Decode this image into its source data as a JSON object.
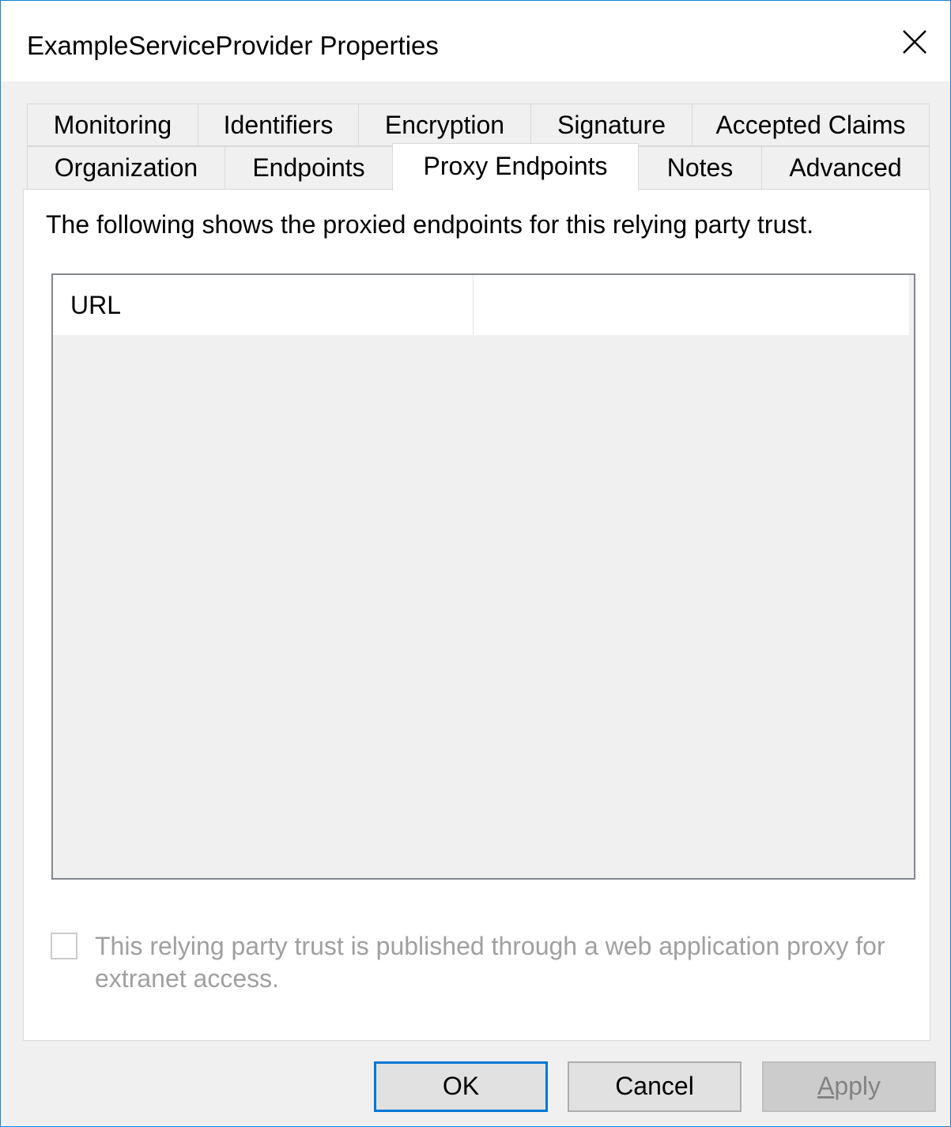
{
  "window": {
    "title": "ExampleServiceProvider Properties",
    "close_icon": "close-icon"
  },
  "tabs": {
    "row1": [
      "Monitoring",
      "Identifiers",
      "Encryption",
      "Signature",
      "Accepted Claims"
    ],
    "row2": [
      "Organization",
      "Endpoints",
      "Proxy Endpoints",
      "Notes",
      "Advanced"
    ],
    "active": "Proxy Endpoints"
  },
  "panel": {
    "description": "The following shows the proxied endpoints for this relying party trust.",
    "list": {
      "columns": [
        "URL",
        ""
      ],
      "rows": []
    },
    "checkbox": {
      "label": "This relying party trust is published through a web application proxy for extranet access.",
      "checked": false,
      "enabled": false
    }
  },
  "buttons": {
    "ok": "OK",
    "cancel": "Cancel",
    "apply_access_key": "A",
    "apply_rest": "pply",
    "apply_enabled": false
  },
  "colors": {
    "accent": "#0078d7",
    "window_border": "#1883d7",
    "disabled_text": "#a0a0a0"
  }
}
